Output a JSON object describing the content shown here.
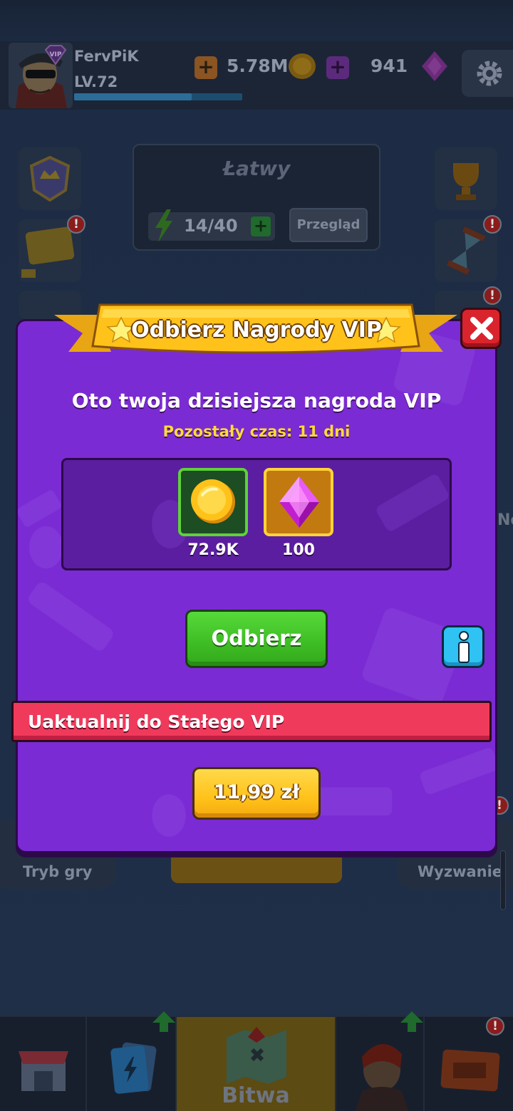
{
  "header": {
    "player_name": "FervPiK",
    "player_level": "LV.72",
    "vip_badge": "VIP",
    "xp_progress": 0.7,
    "coins": "5.78M",
    "gems": "941",
    "icons": [
      "avatar",
      "vip-badge-icon",
      "coin-icon",
      "gem-icon",
      "gear-icon"
    ]
  },
  "mode_panel": {
    "difficulty": "Łatwy",
    "energy": "14/40",
    "review_label": "Przegląd"
  },
  "side_buttons": {
    "game_mode_label": "Tryb gry",
    "challenge_label": "Wyzwanie"
  },
  "bottom_nav": {
    "battle_label": "Bitwa",
    "items": [
      "shop-icon",
      "cards-icon",
      "map-icon",
      "heroes-icon",
      "tickets-icon"
    ]
  },
  "modal": {
    "title": "Odbierz Nagrody VIP",
    "subtitle": "Oto twoja dzisiejsza nagroda VIP",
    "time_left": "Pozostały czas: 11 dni",
    "rewards": [
      {
        "icon": "coin-icon",
        "amount": "72.9K"
      },
      {
        "icon": "gem-icon",
        "amount": "100"
      }
    ],
    "claim_label": "Odbierz",
    "upgrade_label": "Uaktualnij do Stałego VIP",
    "price_label": "11,99 zł"
  },
  "colors": {
    "modal_bg": "#7b2bd3",
    "ribbon": "#ffc21a",
    "claim_green": "#3fbf25",
    "upgrade_red": "#f03a5c",
    "price_gold": "#ffc21a",
    "time_yellow": "#ffd93a"
  }
}
